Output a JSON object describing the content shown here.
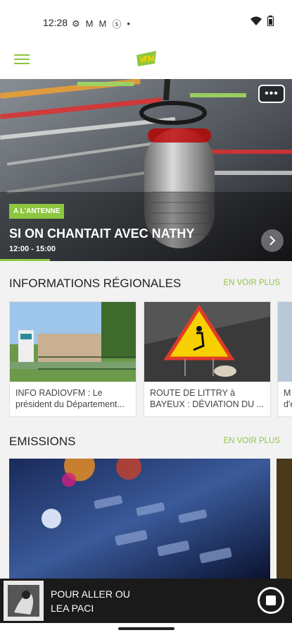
{
  "status": {
    "time": "12:28",
    "icons": [
      "gear-icon",
      "gmail-icon",
      "gmail-icon",
      "app-icon",
      "dot-icon"
    ],
    "right_icons": [
      "wifi-icon",
      "battery-icon"
    ]
  },
  "header": {
    "menu": "hamburger-menu-icon",
    "logo": "radio-logo"
  },
  "hero": {
    "badge": "A L'ANTENNE",
    "title": "SI ON CHANTAIT AVEC NATHY",
    "time": "12:00 - 15:00",
    "progress": 0.17,
    "more_label": "•••"
  },
  "info_section": {
    "title": "INFORMATIONS RÉGIONALES",
    "more": "EN VOIR PLUS",
    "cards": [
      {
        "text": "INFO RADIOVFM : Le président du Département..."
      },
      {
        "text": "ROUTE DE LITTRY à BAYEUX : DÉVIATION DU ..."
      },
      {
        "text": "M\nd'é"
      }
    ]
  },
  "emissions": {
    "title": "EMISSIONS",
    "more": "EN VOIR PLUS"
  },
  "player": {
    "line1": "POUR ALLER OU",
    "line2": "LEA PACI"
  },
  "colors": {
    "accent": "#8dc63f",
    "player_bg": "#1a1a1a"
  }
}
